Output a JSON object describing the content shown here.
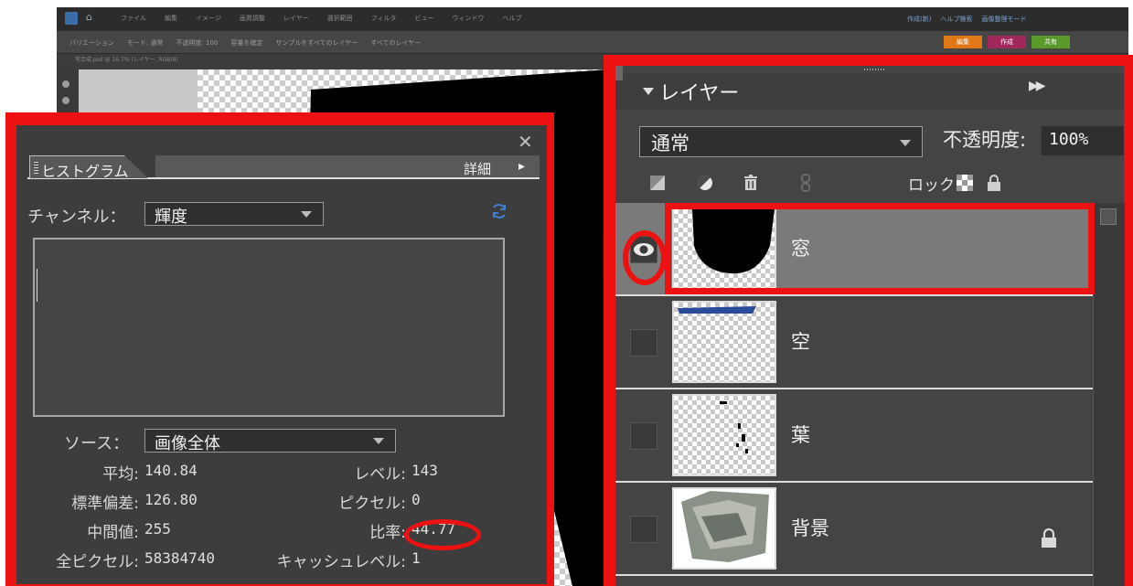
{
  "app": {
    "menu": [
      "ファイル",
      "編集",
      "イメージ",
      "画質調整",
      "レイヤー",
      "選択範囲",
      "フィルタ",
      "ビュー",
      "ウィンドウ",
      "ヘルプ"
    ],
    "top_right": [
      "作成(新)",
      "ヘルプ検索",
      "画像整理モード"
    ],
    "options": [
      "バリエーション",
      "モード: 通常",
      "不透明度: 100",
      "容量を確定",
      "サンプルをすべてのレイヤー",
      "すべてのレイヤー"
    ],
    "mode_buttons": [
      {
        "label": "編集",
        "color": "#e07818"
      },
      {
        "label": "作成",
        "color": "#a0285a"
      },
      {
        "label": "共有",
        "color": "#5a9a2a"
      }
    ],
    "doc_title": "窓合成.psd @ 16.7% (レイヤー, RGB/8)"
  },
  "histogram": {
    "tab": "ヒストグラム",
    "detail": "詳細",
    "channel_label": "チャンネル：",
    "channel_value": "輝度",
    "source_label": "ソース：",
    "source_value": "画像全体",
    "stats": {
      "mean_label": "平均:",
      "mean": "140.84",
      "std_label": "標準偏差:",
      "std": "126.80",
      "median_label": "中間値:",
      "median": "255",
      "pixels_label": "全ピクセル:",
      "pixels": "58384740",
      "level_label": "レベル:",
      "level": "143",
      "count_label": "ピクセル:",
      "count": "0",
      "percentile_label": "比率:",
      "percentile": "44.77",
      "cache_label": "キャッシュレベル:",
      "cache": "1"
    },
    "highlight_color": "#ee1111"
  },
  "layers": {
    "title": "レイヤー",
    "blend_mode": "通常",
    "opacity_label": "不透明度:",
    "opacity_value": "100%",
    "lock_label": "ロック:",
    "items": [
      {
        "name": "窓",
        "visible": true,
        "selected": true
      },
      {
        "name": "空",
        "visible": false,
        "selected": false
      },
      {
        "name": "葉",
        "visible": false,
        "selected": false
      },
      {
        "name": "背景",
        "visible": false,
        "selected": false,
        "locked": true
      }
    ]
  }
}
